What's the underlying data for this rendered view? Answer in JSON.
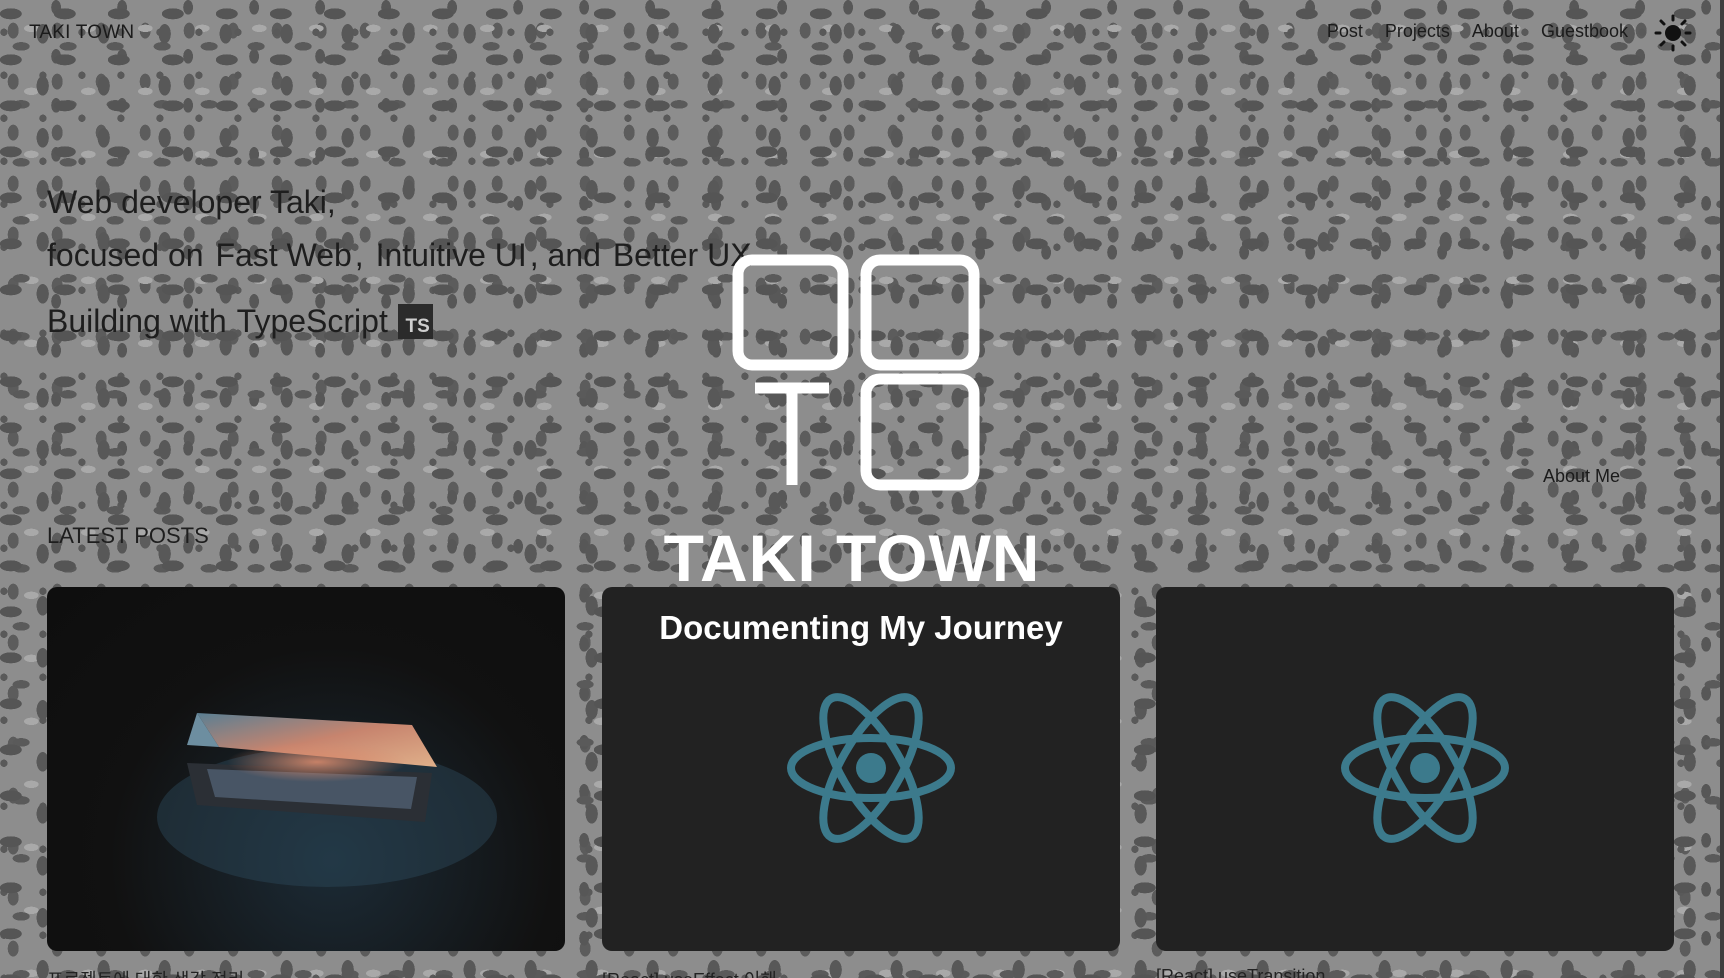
{
  "header": {
    "brand": "TAKI TOWN",
    "nav": [
      "Post",
      "Projects",
      "About",
      "Guestbook"
    ],
    "theme_icon": "sun-icon"
  },
  "intro": {
    "line1": "Web developer Taki,",
    "line2_prefix": "focused on",
    "highlight1": "Fast Web",
    "sep1": ",",
    "highlight2": "Intuitive UI",
    "sep2": ", and",
    "highlight3": "Better UX",
    "line3_prefix": "Building with",
    "line3_tech": "TypeScript",
    "ts_badge": "TS"
  },
  "about_me": "About Me",
  "latest_posts": {
    "heading": "LATEST POSTS",
    "cards": [
      {
        "image": "laptop-photo",
        "title": "",
        "caption": "프로젝트에 대한 생각 정리"
      },
      {
        "image": "react-icon",
        "title": "Documenting My Journey",
        "caption": "[React] useEffect 이해"
      },
      {
        "image": "react-icon",
        "title": "",
        "caption": "[React] useTransition"
      }
    ]
  },
  "overlay_logo": {
    "icon": "taki-town-logo",
    "text": "TAKI TOWN"
  },
  "colors": {
    "react_blue": "#3c7a8c",
    "background": "#8d8d8d",
    "card_dark": "#222222"
  }
}
